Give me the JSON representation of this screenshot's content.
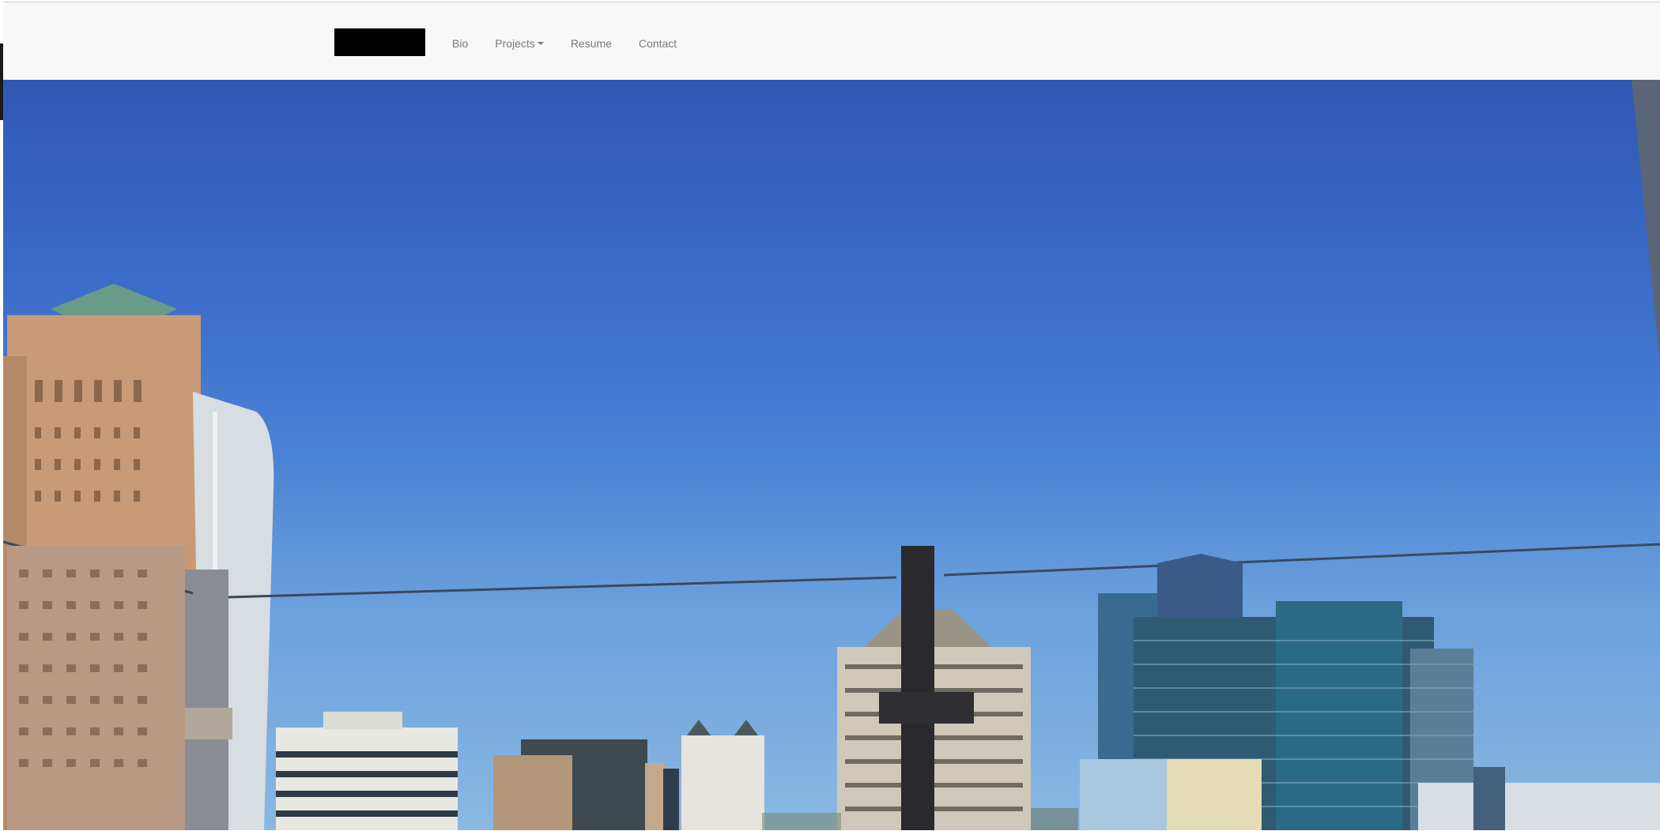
{
  "nav": {
    "brand_label": "",
    "items": [
      {
        "label": "Bio",
        "has_dropdown": false
      },
      {
        "label": "Projects",
        "has_dropdown": true
      },
      {
        "label": "Resume",
        "has_dropdown": false
      },
      {
        "label": "Contact",
        "has_dropdown": false
      }
    ]
  },
  "hero": {
    "description_icon": "city-skyline-photo"
  },
  "colors": {
    "navbar_bg": "#f8f8f8",
    "nav_text": "#777777",
    "brand_block": "#000000",
    "sky_top": "#3058b4",
    "sky_bottom": "#8ab8e2"
  }
}
